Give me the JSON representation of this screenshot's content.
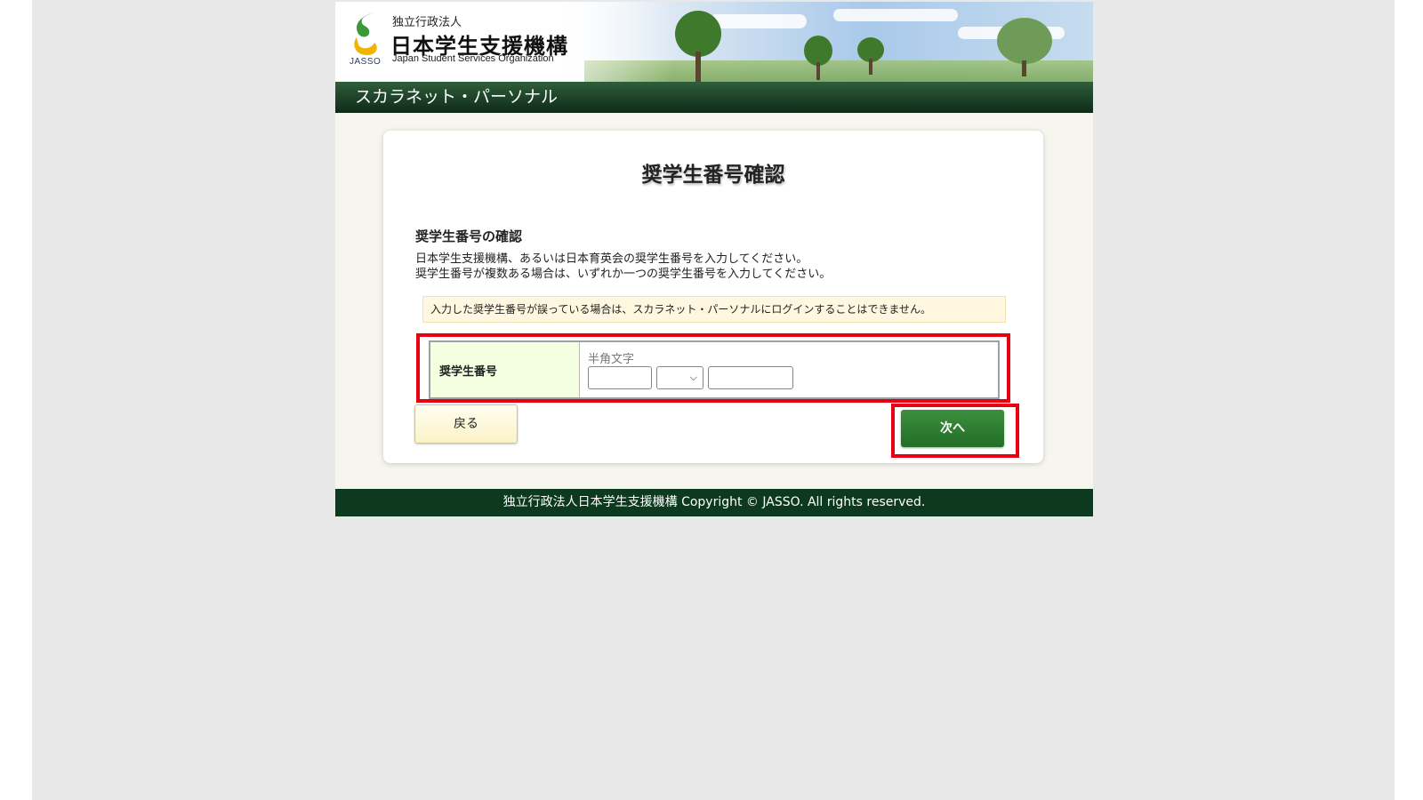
{
  "header": {
    "org_small": "独立行政法人",
    "org_name": "日本学生支援機構",
    "org_english": "Japan Student Services Organization",
    "logo_abbr": "JASSO",
    "system_title": "スカラネット・パーソナル"
  },
  "main": {
    "title": "奨学生番号確認",
    "section_heading": "奨学生番号の確認",
    "description_line1": "日本学生支援機構、あるいは日本育英会の奨学生番号を入力してください。",
    "description_line2": "奨学生番号が複数ある場合は、いずれか一つの奨学生番号を入力してください。",
    "notice": "入力した奨学生番号が誤っている場合は、スカラネット・パーソナルにログインすることはできません。",
    "form": {
      "label": "奨学生番号",
      "hint": "半角文字",
      "field1_value": "",
      "select_value": "",
      "field2_value": ""
    },
    "buttons": {
      "back_label": "戻る",
      "next_label": "次へ"
    }
  },
  "footer": {
    "copyright": "独立行政法人日本学生支援機構 Copyright © JASSO. All rights reserved."
  },
  "colors": {
    "highlight": "#e60012",
    "next_button": "#2e7d32",
    "footer": "#0d3a1e"
  }
}
